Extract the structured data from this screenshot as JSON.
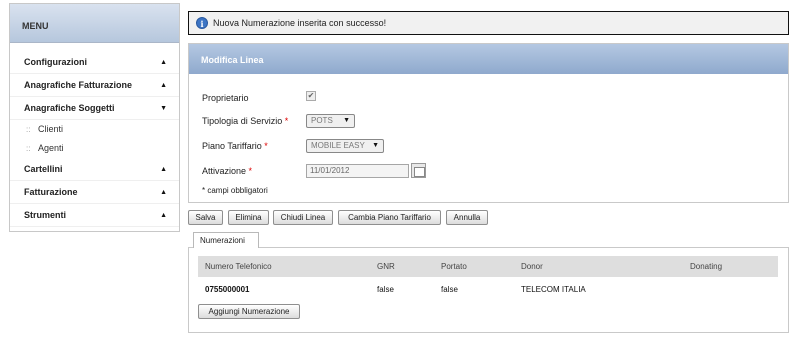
{
  "sidebar": {
    "title": "MENU",
    "items": [
      {
        "label": "Configurazioni",
        "arrow": "▲"
      },
      {
        "label": "Anagrafiche Fatturazione",
        "arrow": "▲"
      },
      {
        "label": "Anagrafiche Soggetti",
        "arrow": "▼"
      }
    ],
    "subitems": [
      {
        "bullet": "::",
        "label": "Clienti"
      },
      {
        "bullet": "::",
        "label": "Agenti"
      }
    ],
    "items_after": [
      {
        "label": "Cartellini",
        "arrow": "▲"
      },
      {
        "label": "Fatturazione",
        "arrow": "▲"
      },
      {
        "label": "Strumenti",
        "arrow": "▲"
      }
    ]
  },
  "info": {
    "icon": "i",
    "message": "Nuova Numerazione inserita con successo!"
  },
  "panel": {
    "title": "Modifica Linea",
    "proprietario_label": "Proprietario",
    "proprietario_checked": true,
    "tipologia_label": "Tipologia di Servizio",
    "tipologia_value": "POTS",
    "piano_label": "Piano Tariffario",
    "piano_value": "MOBILE EASY",
    "attivazione_label": "Attivazione",
    "attivazione_value": "11/01/2012",
    "required_marker": "*",
    "required_note": "* campi obbligatori",
    "dropdown_arrow": "▼",
    "checkmark": "✔"
  },
  "buttons": {
    "salva": "Salva",
    "elimina": "Elimina",
    "chiudi": "Chiudi Linea",
    "cambia": "Cambia Piano Tariffario",
    "annulla": "Annulla"
  },
  "numerazioni": {
    "tab_label": "Numerazioni",
    "columns": [
      "Numero Telefonico",
      "GNR",
      "Portato",
      "Donor",
      "Donating"
    ],
    "rows": [
      [
        "0755000001",
        "false",
        "false",
        "TELECOM ITALIA",
        ""
      ]
    ],
    "add_label": "Aggiungi Numerazione"
  },
  "colors": {
    "menu_header": "#b6c7dd",
    "panel_header": "#8fa9cd",
    "info_icon": "#3c74c4",
    "required": "#dd0000"
  }
}
